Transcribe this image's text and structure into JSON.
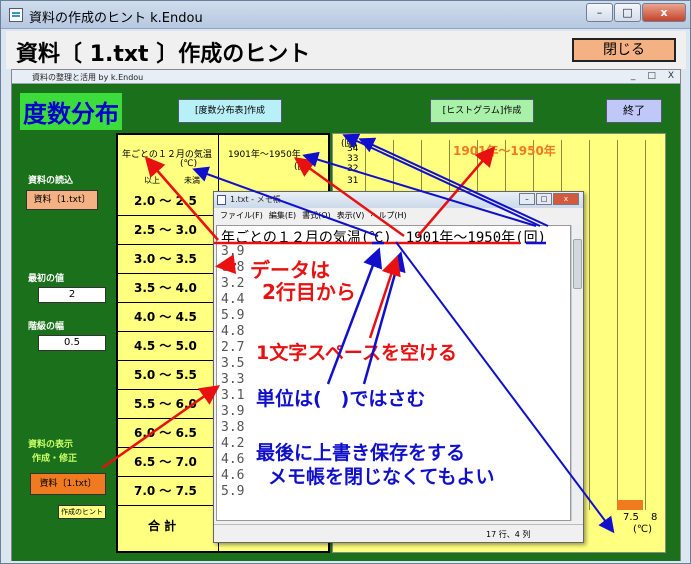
{
  "window": {
    "title": "資料の作成のヒント k.Endou",
    "minimize": "–",
    "maximize": "□",
    "close": "x"
  },
  "header": {
    "title": "資料〔 1.txt 〕作成のヒント",
    "close_button": "閉じる"
  },
  "inner_window": {
    "title": "資料の整理と活用 by k.Endou",
    "min": "_",
    "max": "□",
    "close": "X"
  },
  "main": {
    "big_label": "度数分布",
    "btn_table": "[度数分布表]作成",
    "btn_hist": "[ヒストグラム]作成",
    "btn_end": "終了"
  },
  "sidebar": {
    "load_label": "資料の読込",
    "load_button": "資料〔1.txt〕",
    "first_value_label": "最初の値",
    "first_value": "2",
    "class_width_label": "階級の幅",
    "class_width": "0.5",
    "display_label": "資料の表示",
    "edit_label": "作成・修正",
    "display_button": "資料〔1.txt〕",
    "hint_button": "作成のヒント"
  },
  "table": {
    "head_left": "年ごとの１２月の気温",
    "head_left_unit": "(℃)",
    "head_right": "1901年〜1950年",
    "head_right_unit": "(回)",
    "sub_left": "以上",
    "sub_right": "未満",
    "rows": [
      "2.0 〜 2.5",
      "2.5 〜 3.0",
      "3.0 〜 3.5",
      "3.5 〜 4.0",
      "4.0 〜 4.5",
      "4.5 〜 5.0",
      "5.0 〜 5.5",
      "5.5 〜 6.0",
      "6.0 〜 6.5",
      "6.5 〜 7.0",
      "7.0 〜 7.5"
    ],
    "total": "合 計"
  },
  "chart": {
    "title": "1901年〜1950年",
    "unit_y": "(回)",
    "y_ticks": [
      "34",
      "33",
      "32",
      "31"
    ],
    "x_ticks": [
      "7.5",
      "8"
    ],
    "x_unit": "(℃)"
  },
  "notepad": {
    "title": "1.txt - メモ帳",
    "menu": [
      "ファイル(F)",
      "編集(E)",
      "書式(O)",
      "表示(V)",
      "ヘルプ(H)"
    ],
    "header_line": "年ごとの１２月の気温(℃)　1901年〜1950年(回)",
    "lines": [
      "3.9",
      "6.8",
      "3.2",
      "4.4",
      "5.9",
      "4.8",
      "2.7",
      "3.5",
      "3.3",
      "3.1",
      "3.9",
      "3.8",
      "4.2",
      "4.6",
      "4.6",
      "5.9"
    ],
    "status": "17 行、4 列"
  },
  "annotations": {
    "data_from_1": "データは",
    "data_from_2": "2行目から",
    "space": "1文字スペースを空ける",
    "unit": "単位は(　)ではさむ",
    "save": "最後に上書き保存をする",
    "no_close": "メモ帳を閉じなくてもよい"
  },
  "colors": {
    "green_bg": "#1b701b",
    "yellow_panel": "#ffff80",
    "orange_button": "#f4b183",
    "annotation_red": "#e81010",
    "annotation_blue": "#1010cc",
    "chart_orange": "#f07a20"
  }
}
